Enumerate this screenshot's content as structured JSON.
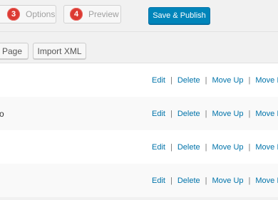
{
  "wizard": {
    "steps": [
      {
        "number": "3",
        "label": "Options"
      },
      {
        "number": "4",
        "label": "Preview"
      }
    ],
    "save_label": "Save & Publish"
  },
  "toolbar": {
    "add_page_label": "l Page",
    "import_label": "Import XML"
  },
  "rows": [
    {
      "label": "",
      "actions": [
        "Edit",
        "Delete",
        "Move Up",
        "Move I"
      ]
    },
    {
      "label": "o",
      "actions": [
        "Edit",
        "Delete",
        "Move Up",
        "Move I"
      ]
    },
    {
      "label": "",
      "actions": [
        "Edit",
        "Delete",
        "Move Up",
        "Move I"
      ]
    },
    {
      "label": "",
      "actions": [
        "Edit",
        "Delete",
        "Move Up",
        "Move I"
      ]
    }
  ],
  "colors": {
    "primary": "#0085ba",
    "link": "#0073aa",
    "step_badge": "#dc3a33"
  }
}
